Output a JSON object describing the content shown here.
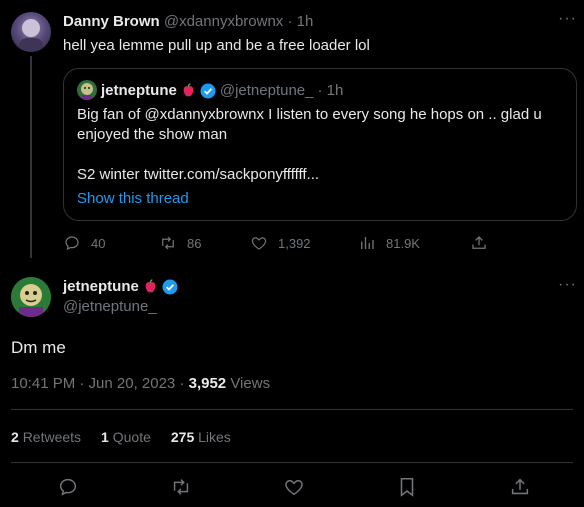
{
  "parent_tweet": {
    "author_name": "Danny Brown",
    "author_handle": "@xdannyxbrownx",
    "time": "· 1h",
    "text": "hell yea lemme pull up and be a free loader lol",
    "quoted": {
      "author_name": "jetneptune",
      "author_handle": "@jetneptune_",
      "time": "· 1h",
      "text_line1": "Big fan of @xdannyxbrownx I listen to every song he hops on .. glad u",
      "text_line2": "enjoyed the show man",
      "text_line3": "S2 winter twitter.com/sackponyffffff...",
      "show_thread": "Show this thread"
    },
    "stats": {
      "replies": "40",
      "retweets": "86",
      "likes": "1,392",
      "views": "81.9K"
    }
  },
  "main_tweet": {
    "author_name": "jetneptune",
    "author_handle": "@jetneptune_",
    "text": "Dm me",
    "time": "10:41 PM · Jun 20, 2023 ·",
    "views_count": "3,952",
    "views_label": "Views",
    "retweets_count": "2",
    "retweets_label": "Retweets",
    "quotes_count": "1",
    "quotes_label": "Quote",
    "likes_count": "275",
    "likes_label": "Likes"
  },
  "colors": {
    "accent": "#1d9bf0",
    "background": "#000000",
    "muted": "#71767b",
    "border": "#2f3336",
    "apple": "#e0245e"
  },
  "icons": [
    "more-icon",
    "apple-emoji-icon",
    "verified-badge-icon",
    "reply-icon",
    "retweet-icon",
    "like-icon",
    "views-icon",
    "share-icon",
    "bookmark-icon"
  ]
}
